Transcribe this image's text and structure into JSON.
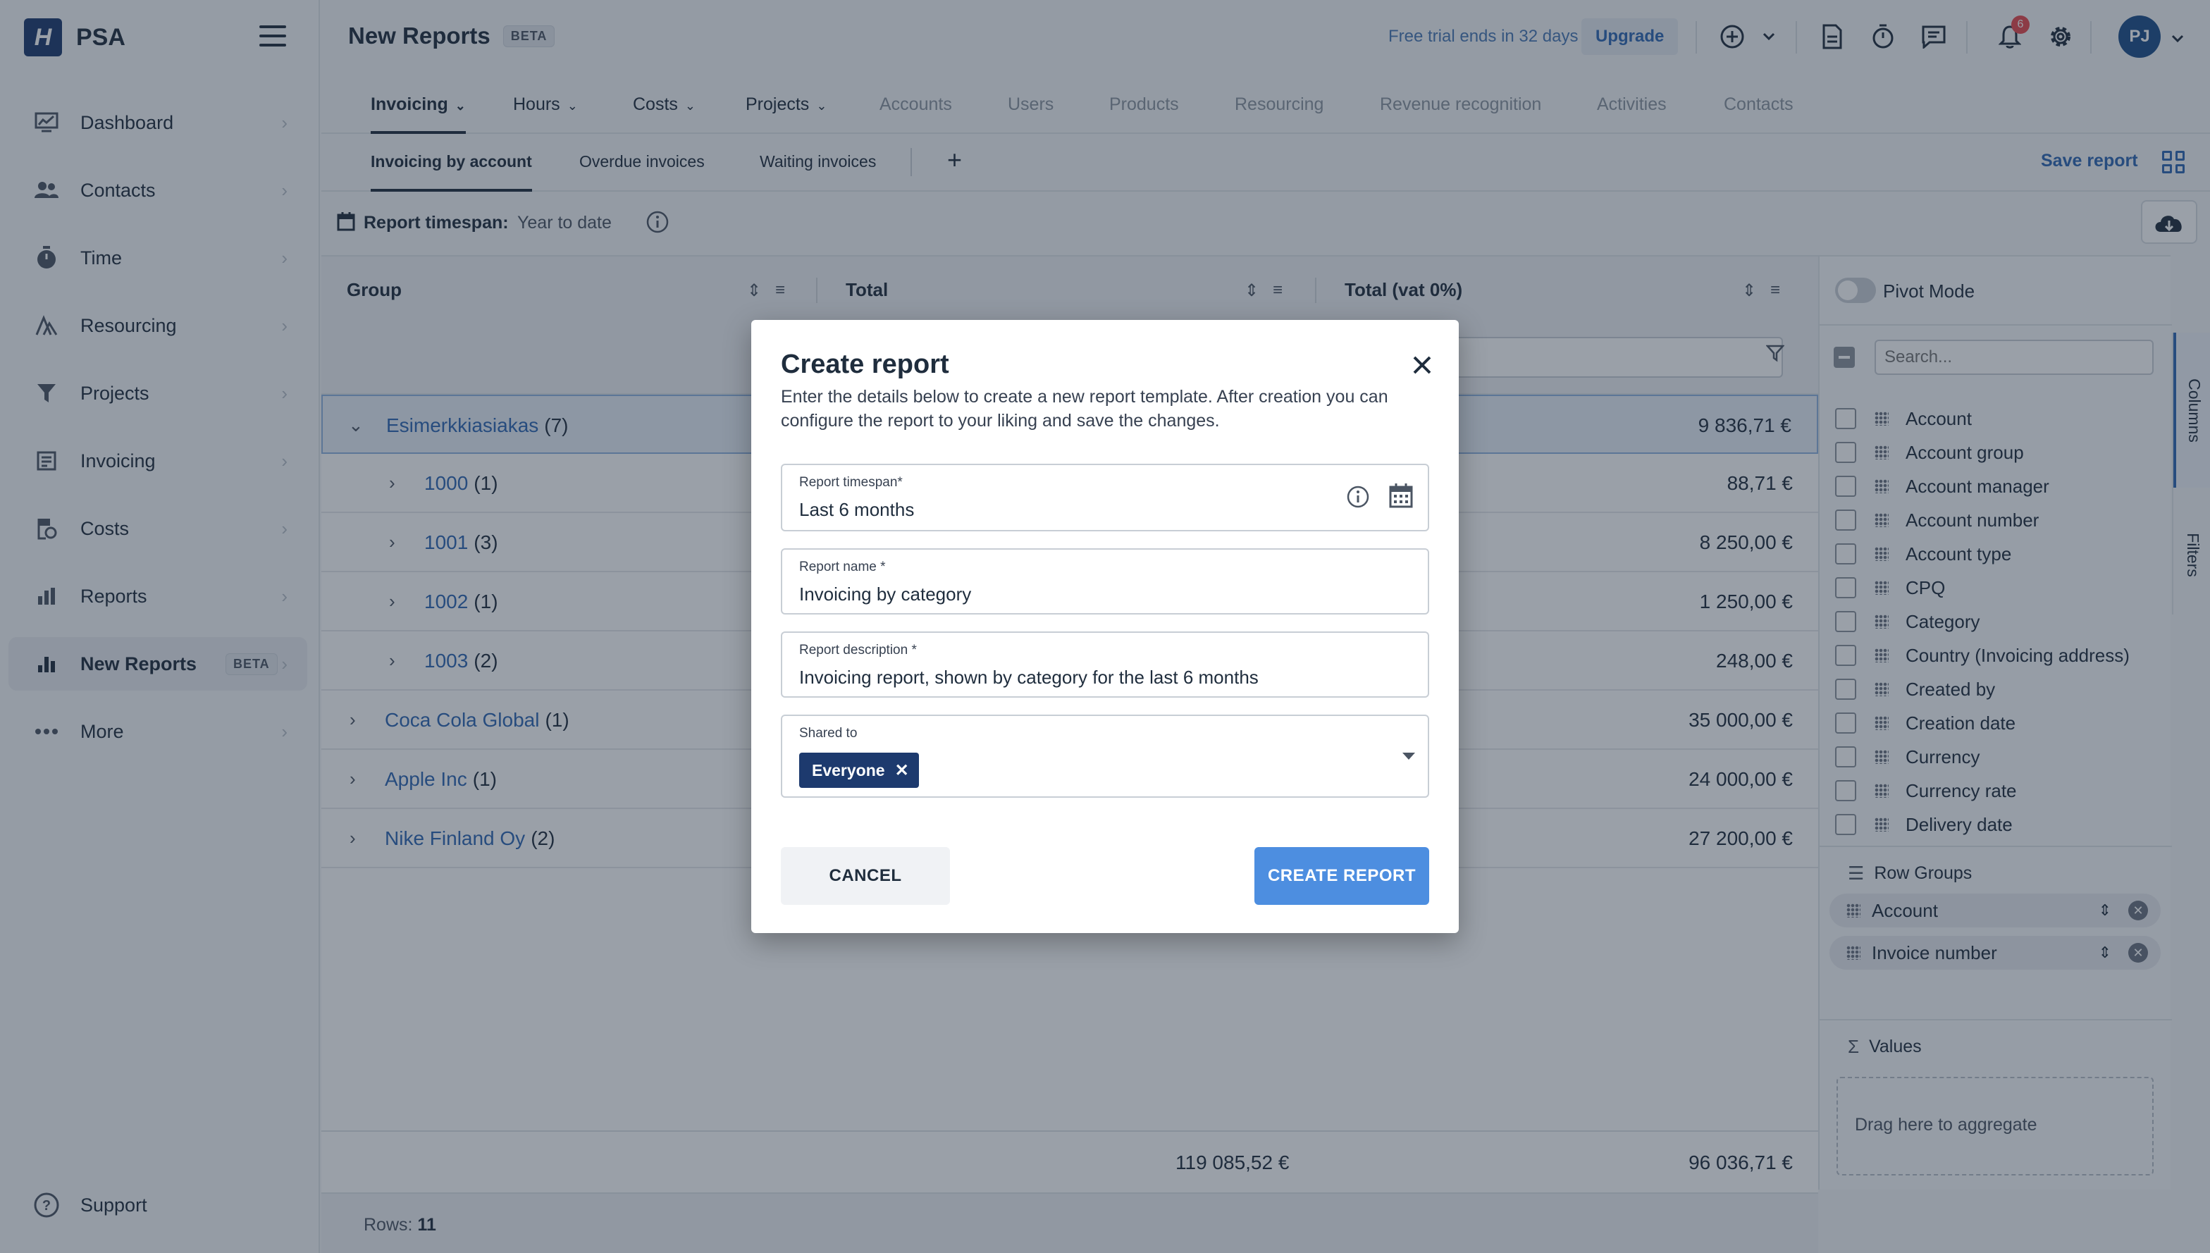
{
  "app": {
    "brand": "PSA",
    "logo_letter": "H"
  },
  "sidebar": {
    "items": [
      {
        "label": "Dashboard",
        "icon": "dashboard-icon"
      },
      {
        "label": "Contacts",
        "icon": "contacts-icon"
      },
      {
        "label": "Time",
        "icon": "stopwatch-icon"
      },
      {
        "label": "Resourcing",
        "icon": "resourcing-icon"
      },
      {
        "label": "Projects",
        "icon": "projects-icon"
      },
      {
        "label": "Invoicing",
        "icon": "invoicing-icon"
      },
      {
        "label": "Costs",
        "icon": "costs-icon"
      },
      {
        "label": "Reports",
        "icon": "reports-icon"
      },
      {
        "label": "New Reports",
        "icon": "new-reports-icon",
        "badge": "BETA",
        "active": true
      },
      {
        "label": "More",
        "icon": "more-dots-icon"
      }
    ],
    "support": "Support"
  },
  "header": {
    "title": "New Reports",
    "title_badge": "BETA",
    "trial_text": "Free trial ends in 32 days",
    "upgrade": "Upgrade",
    "notification_count": "6",
    "avatar_initials": "PJ"
  },
  "tabs": [
    {
      "label": "Invoicing",
      "dropdown": true,
      "active": true
    },
    {
      "label": "Hours",
      "dropdown": true
    },
    {
      "label": "Costs",
      "dropdown": true
    },
    {
      "label": "Projects",
      "dropdown": true
    },
    {
      "label": "Accounts"
    },
    {
      "label": "Users"
    },
    {
      "label": "Products"
    },
    {
      "label": "Resourcing"
    },
    {
      "label": "Revenue recognition"
    },
    {
      "label": "Activities"
    },
    {
      "label": "Contacts"
    }
  ],
  "subtabs": {
    "items": [
      "Invoicing by account",
      "Overdue invoices",
      "Waiting invoices"
    ],
    "add": "+",
    "save_report": "Save report"
  },
  "timespan": {
    "label": "Report timespan:",
    "value": "Year to date"
  },
  "grid": {
    "columns": [
      "Group",
      "Total",
      "Total (vat 0%)"
    ],
    "rows": [
      {
        "name": "Esimerkkiasiakas",
        "count": "(7)",
        "total": "9 836,71 €",
        "level": 0,
        "expanded": true
      },
      {
        "name": "1000",
        "count": "(1)",
        "total": "88,71 €",
        "level": 1
      },
      {
        "name": "1001",
        "count": "(3)",
        "total": "8 250,00 €",
        "level": 1
      },
      {
        "name": "1002",
        "count": "(1)",
        "total": "1 250,00 €",
        "level": 1
      },
      {
        "name": "1003",
        "count": "(2)",
        "total": "248,00 €",
        "level": 1
      },
      {
        "name": "Coca Cola Global",
        "count": "(1)",
        "total": "35 000,00 €",
        "level": 0
      },
      {
        "name": "Apple Inc",
        "count": "(1)",
        "total": "24 000,00 €",
        "level": 0
      },
      {
        "name": "Nike Finland Oy",
        "count": "(2)",
        "total": "27 200,00 €",
        "level": 0
      }
    ],
    "footer_total": "119 085,52 €",
    "footer_total_vat0": "96 036,71 €",
    "rows_label": "Rows:",
    "rows_count": "11"
  },
  "right_panel": {
    "pivot_mode": "Pivot Mode",
    "search_placeholder": "Search...",
    "columns": [
      "Account",
      "Account group",
      "Account manager",
      "Account number",
      "Account type",
      "CPQ",
      "Category",
      "Country (Invoicing address)",
      "Created by",
      "Creation date",
      "Currency",
      "Currency rate",
      "Delivery date"
    ],
    "row_groups_title": "Row Groups",
    "row_groups": [
      "Account",
      "Invoice number"
    ],
    "values_title": "Values",
    "aggregate_hint": "Drag here to aggregate",
    "side_tabs": [
      "Columns",
      "Filters"
    ]
  },
  "modal": {
    "title": "Create report",
    "description": "Enter the details below to create a new report template. After creation you can configure the report to your liking and save the changes.",
    "timespan_label": "Report timespan*",
    "timespan_value": "Last 6 months",
    "name_label": "Report name *",
    "name_value": "Invoicing by category",
    "description_label": "Report description *",
    "description_value": "Invoicing report, shown by category for the last 6 months",
    "shared_label": "Shared to",
    "shared_chip": "Everyone",
    "cancel": "CANCEL",
    "create": "CREATE REPORT"
  },
  "colors": {
    "primary": "#1d3a6e",
    "link": "#2f67b2",
    "create_button": "#4d8ee0",
    "badge": "#e5484d"
  }
}
